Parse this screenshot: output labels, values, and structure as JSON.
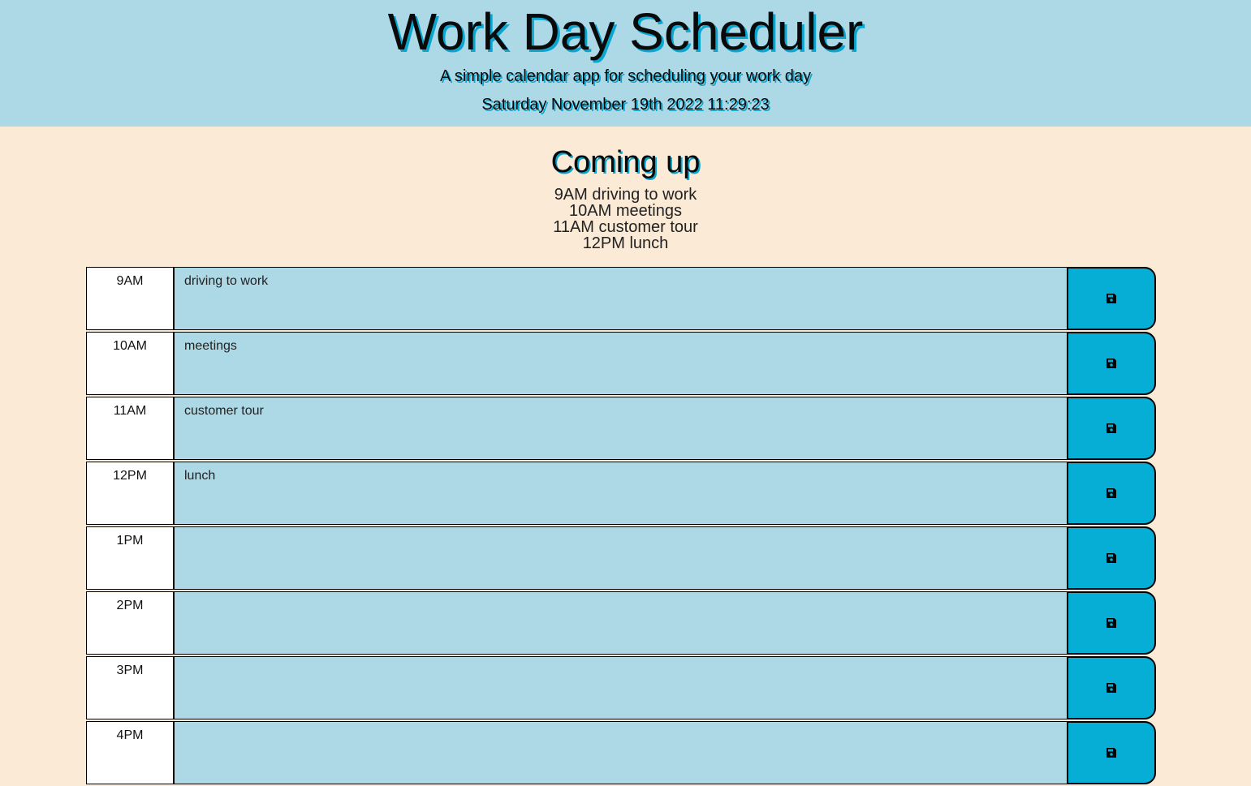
{
  "header": {
    "title": "Work Day Scheduler",
    "lead": "A simple calendar app for scheduling your work day",
    "current_date": "Saturday November 19th 2022 11:29:23"
  },
  "coming_up": {
    "heading": "Coming up",
    "items": [
      "9AM driving to work",
      "10AM meetings",
      "11AM customer tour",
      "12PM lunch"
    ]
  },
  "schedule": {
    "rows": [
      {
        "hour": "9AM",
        "text": "driving to work"
      },
      {
        "hour": "10AM",
        "text": "meetings"
      },
      {
        "hour": "11AM",
        "text": "customer tour"
      },
      {
        "hour": "12PM",
        "text": "lunch"
      },
      {
        "hour": "1PM",
        "text": ""
      },
      {
        "hour": "2PM",
        "text": ""
      },
      {
        "hour": "3PM",
        "text": ""
      },
      {
        "hour": "4PM",
        "text": ""
      }
    ],
    "save_icon": "save-icon"
  },
  "colors": {
    "header_bg": "#add8e6",
    "page_bg": "#faead6",
    "row_bg": "#add8e6",
    "save_bg": "#06aed5",
    "text_shadow": "#0aa6d0"
  }
}
